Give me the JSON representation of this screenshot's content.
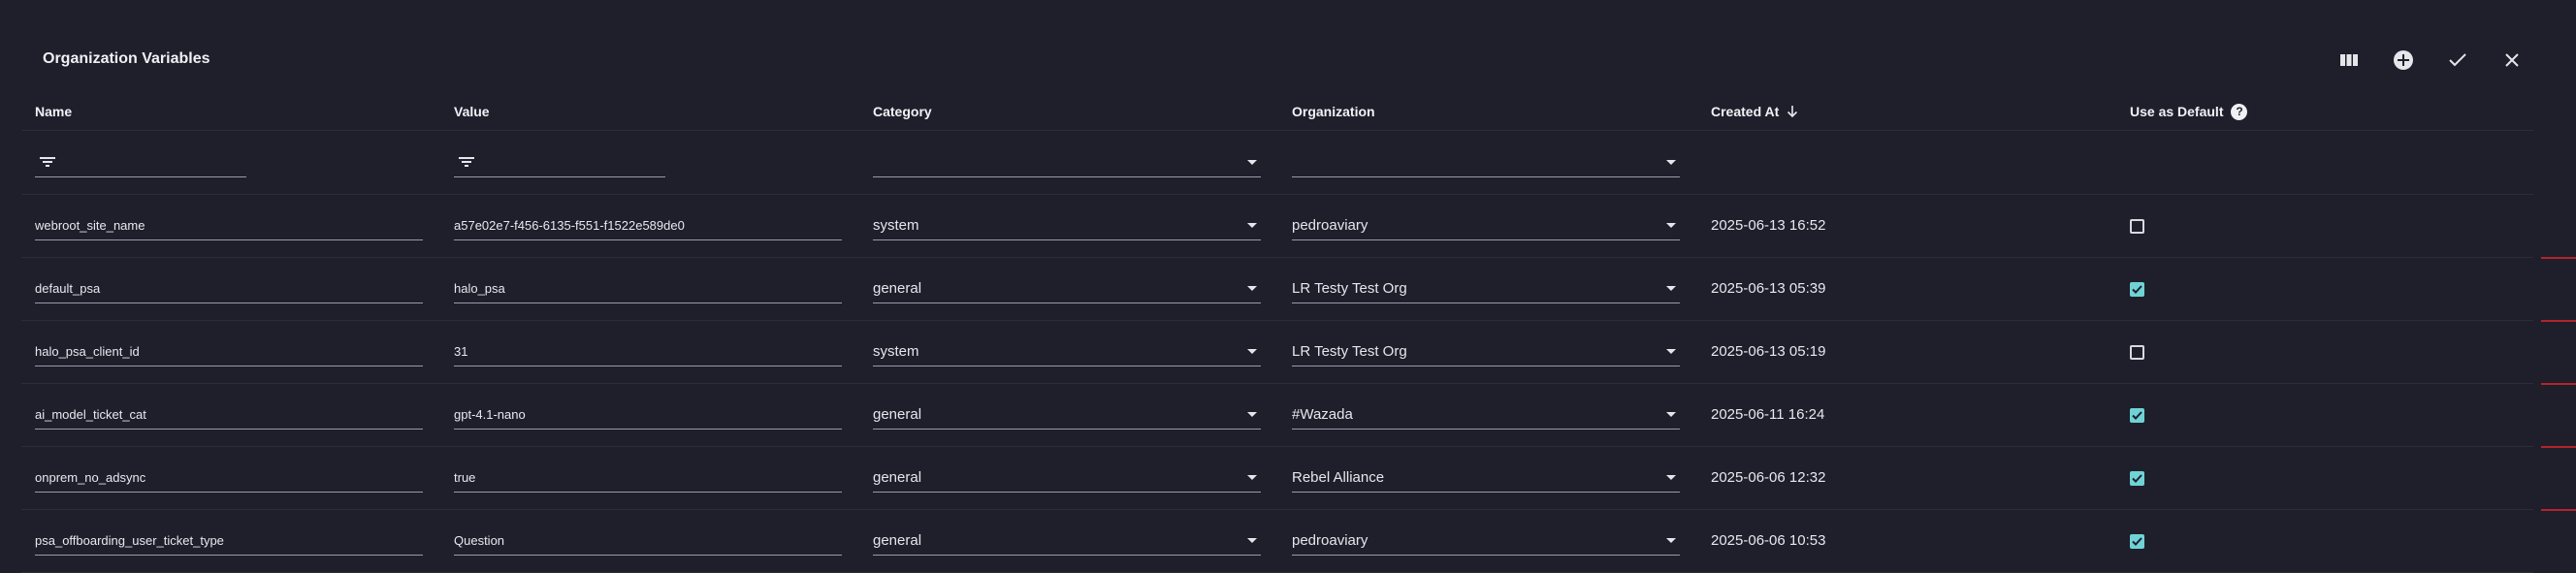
{
  "page": {
    "title": "Organization Variables"
  },
  "toolbar": {
    "columns_icon": "columns-icon",
    "add_icon": "add-circle-icon",
    "save_icon": "check-icon",
    "close_icon": "close-icon"
  },
  "columns": {
    "name": "Name",
    "value": "Value",
    "category": "Category",
    "organization": "Organization",
    "created_at": "Created At",
    "use_as_default": "Use as Default"
  },
  "filters": {
    "name": "",
    "value": "",
    "category": "",
    "organization": ""
  },
  "rows": [
    {
      "name": "webroot_site_name",
      "value": "a57e02e7-f456-6135-f551-f1522e589de0",
      "category": "system",
      "organization": "pedroaviary",
      "created_at": "2025-06-13 16:52",
      "default": false
    },
    {
      "name": "default_psa",
      "value": "halo_psa",
      "category": "general",
      "organization": "LR Testy Test Org",
      "created_at": "2025-06-13 05:39",
      "default": true
    },
    {
      "name": "halo_psa_client_id",
      "value": "31",
      "category": "system",
      "organization": "LR Testy Test Org",
      "created_at": "2025-06-13 05:19",
      "default": false
    },
    {
      "name": "ai_model_ticket_cat",
      "value": "gpt-4.1-nano",
      "category": "general",
      "organization": "#Wazada",
      "created_at": "2025-06-11 16:24",
      "default": true
    },
    {
      "name": "onprem_no_adsync",
      "value": "true",
      "category": "general",
      "organization": "Rebel Alliance",
      "created_at": "2025-06-06 12:32",
      "default": true
    },
    {
      "name": "psa_offboarding_user_ticket_type",
      "value": "Question",
      "category": "general",
      "organization": "pedroaviary",
      "created_at": "2025-06-06 10:53",
      "default": true
    }
  ],
  "colors": {
    "background": "#1e1f2b",
    "checkbox_checked": "#6fd3d6",
    "marker": "#b3242b"
  }
}
